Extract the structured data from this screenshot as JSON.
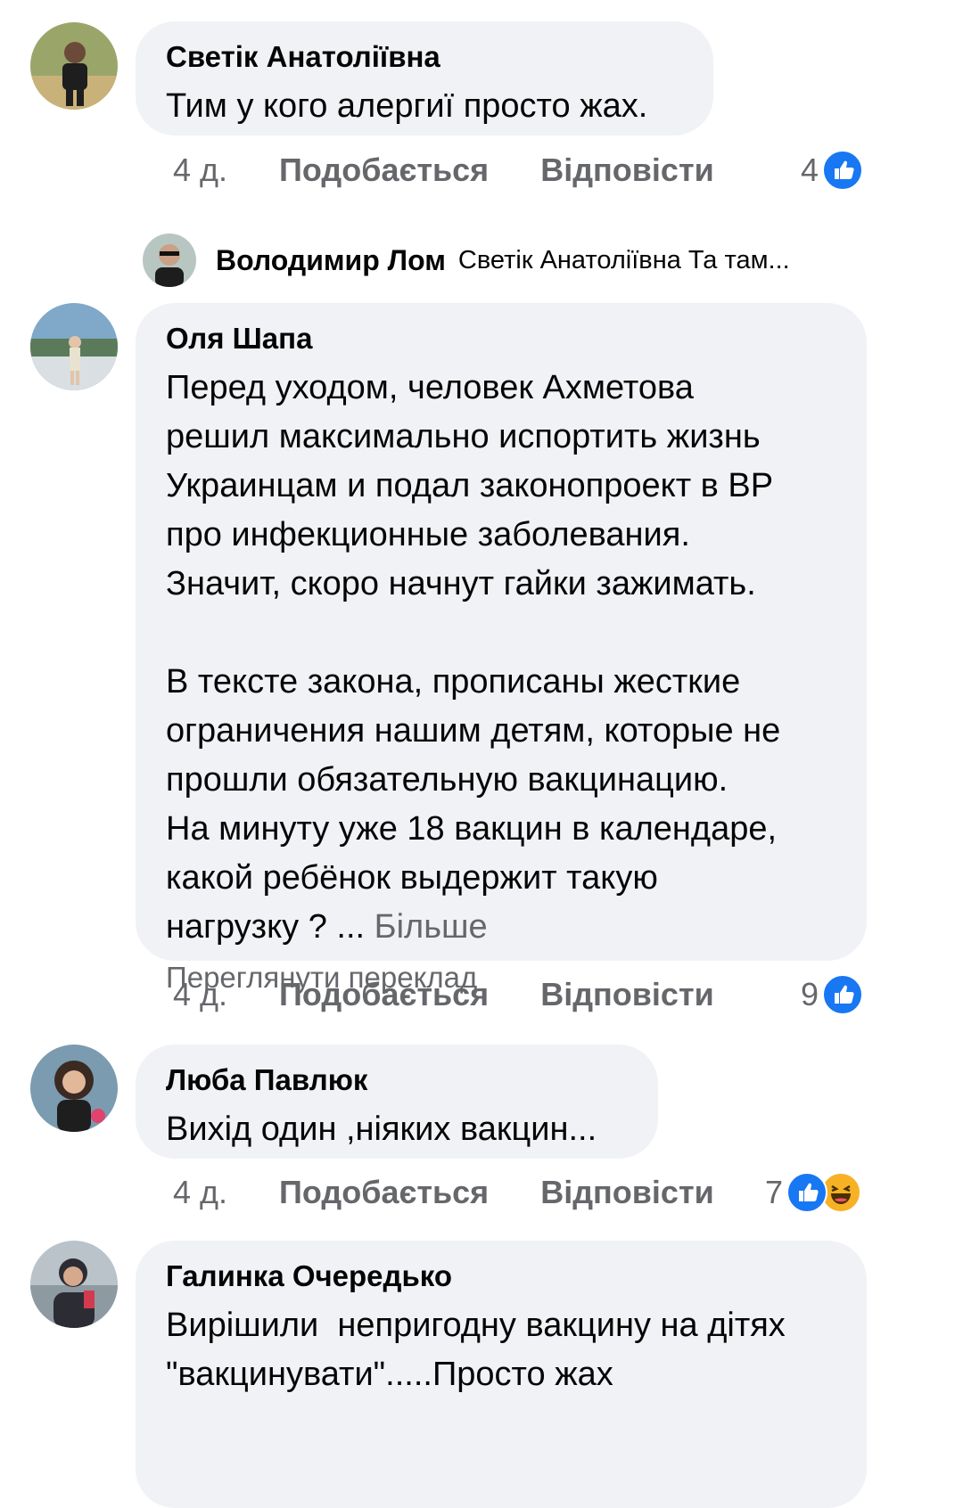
{
  "comments": [
    {
      "author": "Светік Анатоліївна",
      "text": "Тим у кого алергиї просто жах.",
      "time": "4 д.",
      "like_label": "Подобається",
      "reply_label": "Відповісти",
      "reaction_count": "4",
      "reactions": [
        "like-icon"
      ],
      "avatar_colors": [
        "#9aa56a",
        "#2a2a2a"
      ]
    },
    {
      "author": "Оля Шапа",
      "text": "Перед уходом, человек Ахметова\nрешил максимально испортить жизнь\nУкраинцам и подал законопроект в ВР\nпро инфекционные заболевания.\nЗначит, скоро начнут гайки зажимать.\n\nВ тексте закона, прописаны жесткие\nограничения нашим детям, которые не\nпрошли обязательную вакцинацию.\nНа минуту уже 18 вакцин в календаре,\nкакой ребёнок выдержит такую\nнагрузку ? ...",
      "more_label": "Більше",
      "translate_label": "Переглянути переклад",
      "time": "4 д.",
      "like_label": "Подобається",
      "reply_label": "Відповісти",
      "reaction_count": "9",
      "reactions": [
        "like-icon"
      ],
      "avatar_colors": [
        "#7fa8c9",
        "#e8e2d0"
      ]
    },
    {
      "author": "Люба Павлюк",
      "text": "Вихід один ,ніяких вакцин...",
      "time": "4 д.",
      "like_label": "Подобається",
      "reply_label": "Відповісти",
      "reaction_count": "7",
      "reactions": [
        "like-icon",
        "haha-icon"
      ],
      "avatar_colors": [
        "#c98b6b",
        "#3b2a22"
      ]
    },
    {
      "author": "Галинка Очередько",
      "text": "Вирішили  непригодну вакцину на дітях\n\"вакцинувати\".....Просто жах",
      "avatar_colors": [
        "#b9c3c9",
        "#2c2c34"
      ]
    }
  ],
  "reply": {
    "author": "Володимир Лом",
    "text": "Светік Анатоліївна Та там...",
    "avatar_colors": [
      "#b7c6c0",
      "#1d1d1d"
    ]
  }
}
